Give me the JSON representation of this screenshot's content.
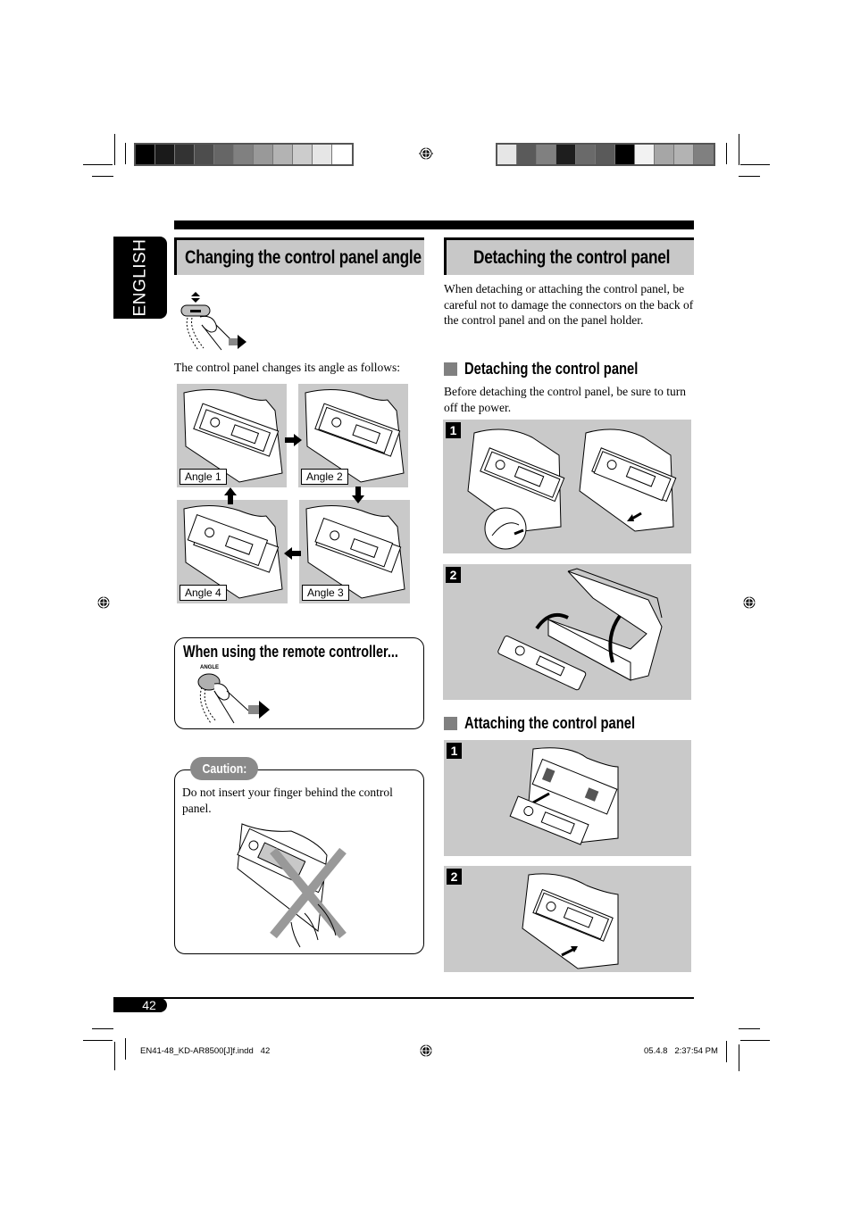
{
  "sidebar_tab": {
    "label": "ENGLISH"
  },
  "color_bars": {
    "left": [
      "#000000",
      "#1a1a1a",
      "#333333",
      "#4d4d4d",
      "#666666",
      "#808080",
      "#999999",
      "#b3b3b3",
      "#cccccc",
      "#e6e6e6",
      "#ffffff"
    ],
    "right": [
      "#e6e6e6",
      "#5a5a5a",
      "#808080",
      "#1e1e1e",
      "#6a6a6a",
      "#5a5a5a",
      "#000000",
      "#f2f2f2",
      "#a6a6a6",
      "#b3b3b3",
      "#808080"
    ]
  },
  "left_section": {
    "title": "Changing the control panel angle",
    "intro": "The control panel changes its angle as follows:",
    "angles": [
      {
        "label": "Angle 1"
      },
      {
        "label": "Angle 2"
      },
      {
        "label": "Angle 3"
      },
      {
        "label": "Angle 4"
      }
    ],
    "remote_box": {
      "title": "When using the remote controller...",
      "button_label": "ANGLE"
    },
    "caution": {
      "label": "Caution:",
      "text": "Do not insert your finger behind the control panel."
    }
  },
  "right_section": {
    "title": "Detaching the control panel",
    "intro": "When detaching or attaching the control panel, be careful not to damage the connectors on the back of the control panel and on the panel holder.",
    "detaching": {
      "title": "Detaching the control panel",
      "text": "Before detaching the control panel, be sure to turn off the power.",
      "steps": [
        {
          "num": "1"
        },
        {
          "num": "2"
        }
      ]
    },
    "attaching": {
      "title": "Attaching the control panel",
      "steps": [
        {
          "num": "1"
        },
        {
          "num": "2"
        }
      ]
    }
  },
  "footer": {
    "page_number": "42",
    "slug_left": "EN41-48_KD-AR8500[J]f.indd   42",
    "slug_right": "05.4.8   2:37:54 PM"
  }
}
